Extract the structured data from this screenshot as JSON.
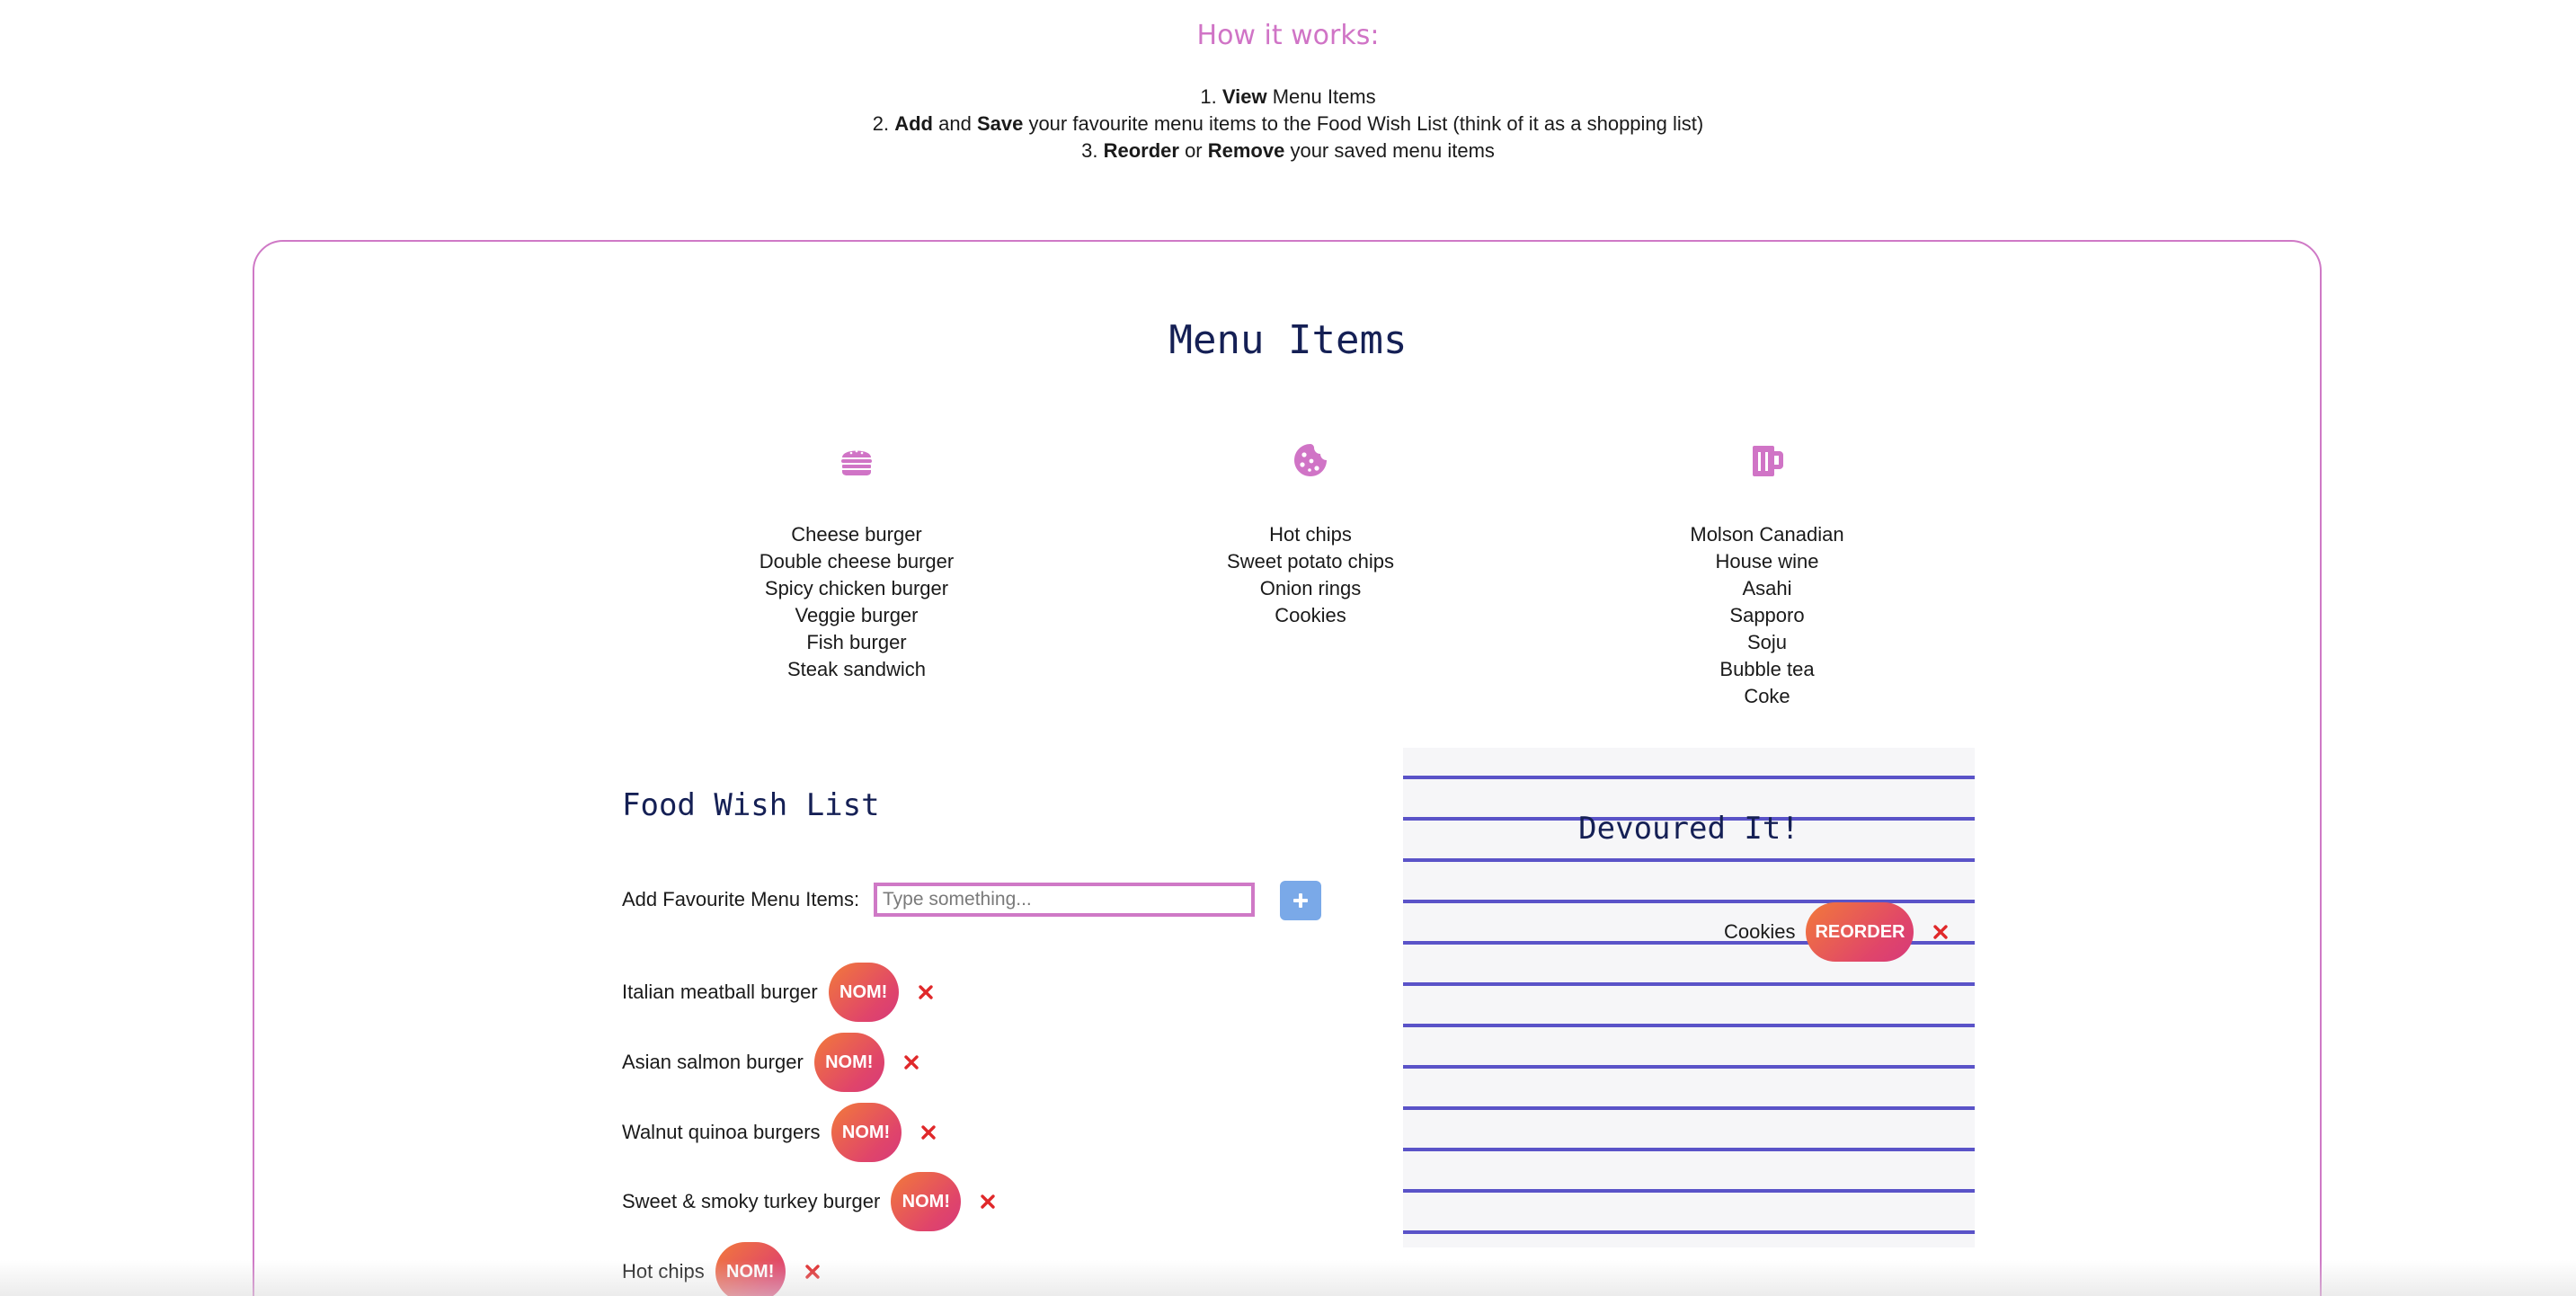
{
  "how_it_works": {
    "title": "How it works:",
    "step1": {
      "num": "1.",
      "bold1": "View",
      "text1": " Menu Items"
    },
    "step2": {
      "num": "2.",
      "bold1": "Add",
      "text1": " and ",
      "bold2": "Save",
      "text2": " your favourite menu items to the Food Wish List (think of it as a shopping list)"
    },
    "step3": {
      "num": "3.",
      "bold1": "Reorder",
      "text1": " or ",
      "bold2": "Remove",
      "text2": " your saved menu items"
    }
  },
  "menu": {
    "title": "Menu Items",
    "columns": [
      {
        "icon": "hamburger-icon",
        "items": [
          "Cheese burger",
          "Double cheese burger",
          "Spicy chicken burger",
          "Veggie burger",
          "Fish burger",
          "Steak sandwich"
        ]
      },
      {
        "icon": "cookie-icon",
        "items": [
          "Hot chips",
          "Sweet potato chips",
          "Onion rings",
          "Cookies"
        ]
      },
      {
        "icon": "beer-mug-icon",
        "items": [
          "Molson Canadian",
          "House wine",
          "Asahi",
          "Sapporo",
          "Soju",
          "Bubble tea",
          "Coke"
        ]
      }
    ]
  },
  "wish_list": {
    "title": "Food Wish List",
    "add_label": "Add Favourite Menu Items:",
    "input_placeholder": "Type something...",
    "input_value": "",
    "add_button_icon": "plus-icon",
    "nom_label": "NOM!",
    "remove_icon": "close-icon",
    "items": [
      "Italian meatball burger",
      "Asian salmon burger",
      "Walnut quinoa burgers",
      "Sweet & smoky turkey burger",
      "Hot chips"
    ]
  },
  "devoured": {
    "title": "Devoured It!",
    "reorder_label": "REORDER",
    "items": [
      "Cookies"
    ]
  },
  "colors": {
    "accent_pink": "#cf79c6",
    "heading_navy": "#152055",
    "button_gradient_start": "#f27a3a",
    "button_gradient_end": "#d63a7a",
    "remove_red": "#e0282a",
    "add_button_blue": "#7aa9e8",
    "ruled_line_blue": "#5a53c8"
  }
}
